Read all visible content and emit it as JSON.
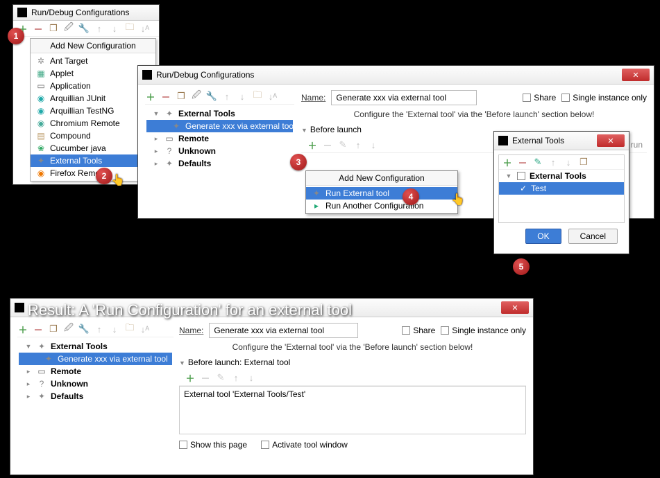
{
  "dialog_title": "Run/Debug Configurations",
  "add_new_header": "Add New Configuration",
  "config_types": [
    {
      "label": "Ant Target",
      "icon": "✲",
      "cls": "ic-ant"
    },
    {
      "label": "Applet",
      "icon": "▦",
      "cls": "ic-applet"
    },
    {
      "label": "Application",
      "icon": "▭",
      "cls": "ic-app"
    },
    {
      "label": "Arquillian JUnit",
      "icon": "◉",
      "cls": "ic-arq"
    },
    {
      "label": "Arquillian TestNG",
      "icon": "◉",
      "cls": "ic-arq"
    },
    {
      "label": "Chromium Remote",
      "icon": "◉",
      "cls": "ic-chr"
    },
    {
      "label": "Compound",
      "icon": "▤",
      "cls": "ic-cmp"
    },
    {
      "label": "Cucumber java",
      "icon": "❀",
      "cls": "ic-cucumber"
    },
    {
      "label": "External Tools",
      "icon": "✦",
      "cls": "ic-ext",
      "sel": true
    },
    {
      "label": "Firefox Remote",
      "icon": "◉",
      "cls": "ic-ff"
    }
  ],
  "name_label": "Name:",
  "name_value": "Generate xxx via external tool",
  "share_label": "Share",
  "single_label": "Single instance only",
  "configure_hint": "Configure the 'External tool' via the 'Before launch' section below!",
  "before_launch_label": "Before launch",
  "tree_main": [
    {
      "label": "External Tools",
      "icon": "✦",
      "cls": "ic-ext",
      "expanded": true,
      "children": [
        {
          "label": "Generate xxx via external tool",
          "icon": "✦",
          "cls": "ic-ext",
          "sel": true
        }
      ]
    },
    {
      "label": "Remote",
      "icon": "▭",
      "cls": "ic-remote"
    },
    {
      "label": "Unknown",
      "icon": "?",
      "cls": "ic-unknown"
    },
    {
      "label": "Defaults",
      "icon": "✦",
      "cls": "ic-defaults"
    }
  ],
  "submenu": {
    "header": "Add New Configuration",
    "items": [
      {
        "label": "Run External tool",
        "icon": "✦",
        "cls": "ic-ext",
        "sel": true
      },
      {
        "label": "Run Another Configuration",
        "icon": "▸",
        "cls": "ic-run"
      }
    ]
  },
  "ext_dialog": {
    "title": "External Tools",
    "tree": {
      "root": "External Tools",
      "child": "Test"
    },
    "ok": "OK",
    "cancel": "Cancel"
  },
  "result_title": "Result: A 'Run Configuration' for an external tool",
  "result": {
    "before_launch": "Before launch: External tool",
    "task": "External tool 'External Tools/Test'",
    "show_page": "Show this page",
    "activate": "Activate tool window"
  },
  "tasks_hint": "sks to run"
}
